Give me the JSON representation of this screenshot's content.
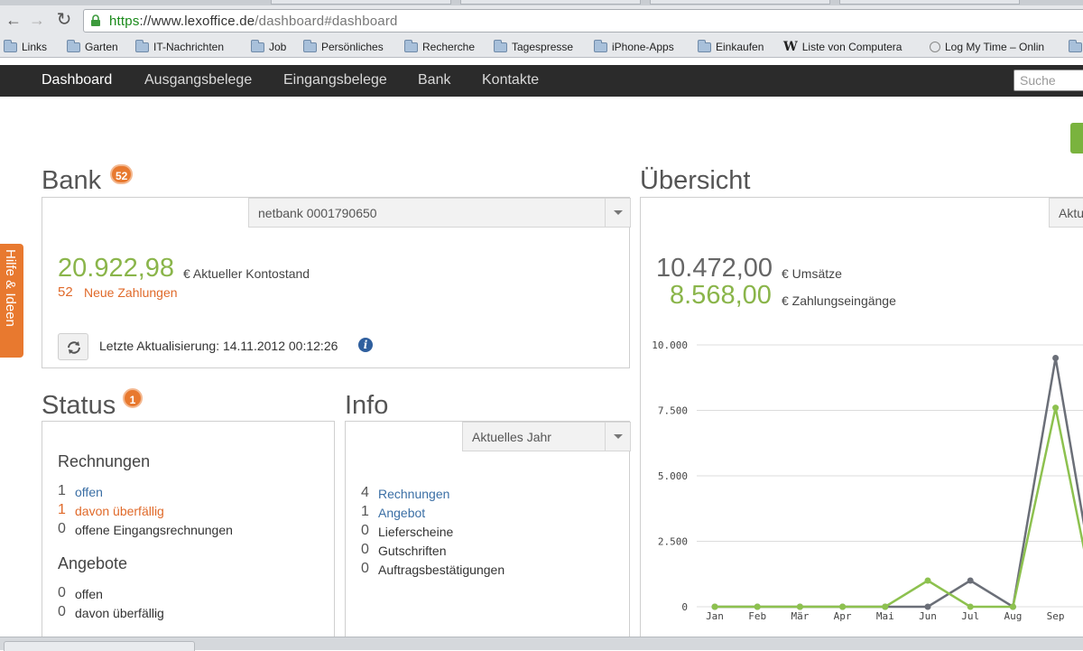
{
  "browser": {
    "url_scheme": "https",
    "url_domain": "://www.lexoffice.de",
    "url_path": "/dashboard#dashboard",
    "bookmarks": [
      {
        "label": "Links",
        "icon": "folder-icon"
      },
      {
        "label": "Garten",
        "icon": "folder-icon"
      },
      {
        "label": "IT-Nachrichten",
        "icon": "folder-icon"
      },
      {
        "label": "Job",
        "icon": "folder-icon"
      },
      {
        "label": "Persönliches",
        "icon": "folder-icon"
      },
      {
        "label": "Recherche",
        "icon": "folder-icon"
      },
      {
        "label": "Tagespresse",
        "icon": "folder-icon"
      },
      {
        "label": "iPhone-Apps",
        "icon": "folder-icon"
      },
      {
        "label": "Einkaufen",
        "icon": "folder-icon"
      },
      {
        "label": "Liste von Computera",
        "icon": "wikipedia-icon"
      },
      {
        "label": "Log My Time – Onlin",
        "icon": "clock-icon"
      }
    ]
  },
  "nav": {
    "items": [
      {
        "label": "Dashboard",
        "active": true
      },
      {
        "label": "Ausgangsbelege",
        "active": false
      },
      {
        "label": "Eingangsbelege",
        "active": false
      },
      {
        "label": "Bank",
        "active": false
      },
      {
        "label": "Kontakte",
        "active": false
      }
    ],
    "search_placeholder": "Suche"
  },
  "help_tab": {
    "label": "Hilfe & Ideen"
  },
  "bank": {
    "title": "Bank",
    "badge": "52",
    "account_select": "netbank 0001790650",
    "balance": "20.922,98",
    "balance_label": "€ Aktueller Kontostand",
    "new_payments_count": "52",
    "new_payments_label": "Neue Zahlungen",
    "last_update": "Letzte Aktualisierung: 14.11.2012 00:12:26"
  },
  "status": {
    "title": "Status",
    "badge": "1",
    "rechnungen_heading": "Rechnungen",
    "rechnungen": [
      {
        "count": "1",
        "label": "offen",
        "style": "link"
      },
      {
        "count": "1",
        "label": "davon überfällig",
        "style": "orange"
      },
      {
        "count": "0",
        "label": "offene Eingangsrechnungen",
        "style": "plain"
      }
    ],
    "angebote_heading": "Angebote",
    "angebote": [
      {
        "count": "0",
        "label": "offen",
        "style": "plain"
      },
      {
        "count": "0",
        "label": "davon überfällig",
        "style": "plain"
      }
    ]
  },
  "info": {
    "title": "Info",
    "period_select": "Aktuelles Jahr",
    "items": [
      {
        "count": "4",
        "label": "Rechnungen",
        "style": "link"
      },
      {
        "count": "1",
        "label": "Angebot",
        "style": "link"
      },
      {
        "count": "0",
        "label": "Lieferscheine",
        "style": "plain"
      },
      {
        "count": "0",
        "label": "Gutschriften",
        "style": "plain"
      },
      {
        "count": "0",
        "label": "Auftragsbestätigungen",
        "style": "plain"
      }
    ]
  },
  "overview": {
    "title": "Übersicht",
    "period_select": "Aktu",
    "umsatz": "10.472,00",
    "umsatz_label": "€ Umsätze",
    "zahlungseingaenge": "8.568,00",
    "zahlungseingaenge_label": "€ Zahlungseingänge"
  },
  "chart_data": {
    "type": "line",
    "categories": [
      "Jan",
      "Feb",
      "Mär",
      "Apr",
      "Mai",
      "Jun",
      "Jul",
      "Aug",
      "Sep"
    ],
    "ylim": [
      0,
      10000
    ],
    "yticks": [
      "10.000",
      "7.500",
      "5.000",
      "2.500",
      "0"
    ],
    "ytick_values": [
      10000,
      7500,
      5000,
      2500,
      0
    ],
    "series": [
      {
        "color": "#6b6f78",
        "values": [
          0,
          0,
          0,
          0,
          0,
          0,
          1000,
          0,
          9500
        ]
      },
      {
        "color": "#8dc14f",
        "values": [
          0,
          0,
          0,
          0,
          0,
          1000,
          0,
          0,
          7600
        ]
      }
    ],
    "grid": true
  }
}
